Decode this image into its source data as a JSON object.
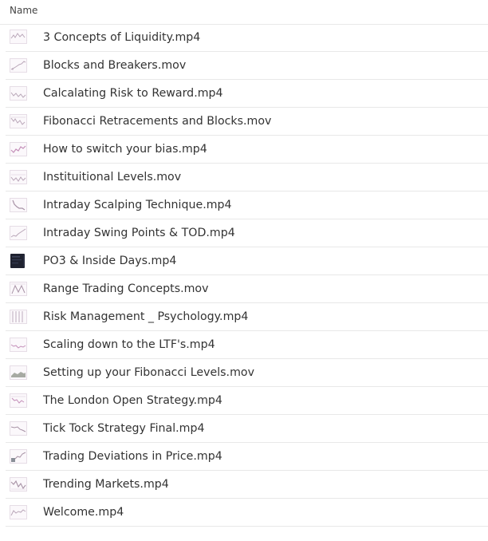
{
  "header": {
    "name_column": "Name"
  },
  "files": [
    {
      "name": "3 Concepts of Liquidity.mp4",
      "icon": "chart-thumbnail-icon"
    },
    {
      "name": "Blocks and Breakers.mov",
      "icon": "chart-thumbnail-icon"
    },
    {
      "name": "Calcalating Risk to Reward.mp4",
      "icon": "chart-thumbnail-icon"
    },
    {
      "name": "Fibonacci Retracements and Blocks.mov",
      "icon": "chart-thumbnail-icon"
    },
    {
      "name": "How to switch your bias.mp4",
      "icon": "chart-thumbnail-icon"
    },
    {
      "name": "Instituitional Levels.mov",
      "icon": "chart-thumbnail-icon"
    },
    {
      "name": "Intraday Scalping Technique.mp4",
      "icon": "chart-thumbnail-icon"
    },
    {
      "name": "Intraday Swing Points & TOD.mp4",
      "icon": "chart-thumbnail-icon"
    },
    {
      "name": "PO3 & Inside Days.mp4",
      "icon": "dark-video-thumbnail-icon"
    },
    {
      "name": "Range Trading Concepts.mov",
      "icon": "chart-thumbnail-icon"
    },
    {
      "name": "Risk Management _ Psychology.mp4",
      "icon": "chart-thumbnail-icon"
    },
    {
      "name": "Scaling down to the LTF's.mp4",
      "icon": "chart-thumbnail-icon"
    },
    {
      "name": "Setting up your Fibonacci Levels.mov",
      "icon": "chart-thumbnail-icon"
    },
    {
      "name": "The London Open Strategy.mp4",
      "icon": "chart-thumbnail-icon"
    },
    {
      "name": "Tick Tock Strategy Final.mp4",
      "icon": "chart-thumbnail-icon"
    },
    {
      "name": "Trading Deviations in Price.mp4",
      "icon": "chart-thumbnail-icon"
    },
    {
      "name": "Trending Markets.mp4",
      "icon": "chart-thumbnail-icon"
    },
    {
      "name": "Welcome.mp4",
      "icon": "chart-thumbnail-icon"
    }
  ],
  "colors": {
    "text": "#333333",
    "divider": "#e8e8e8",
    "thumb_line": "#b9a6b8",
    "thumb_dark": "#1f2230"
  }
}
